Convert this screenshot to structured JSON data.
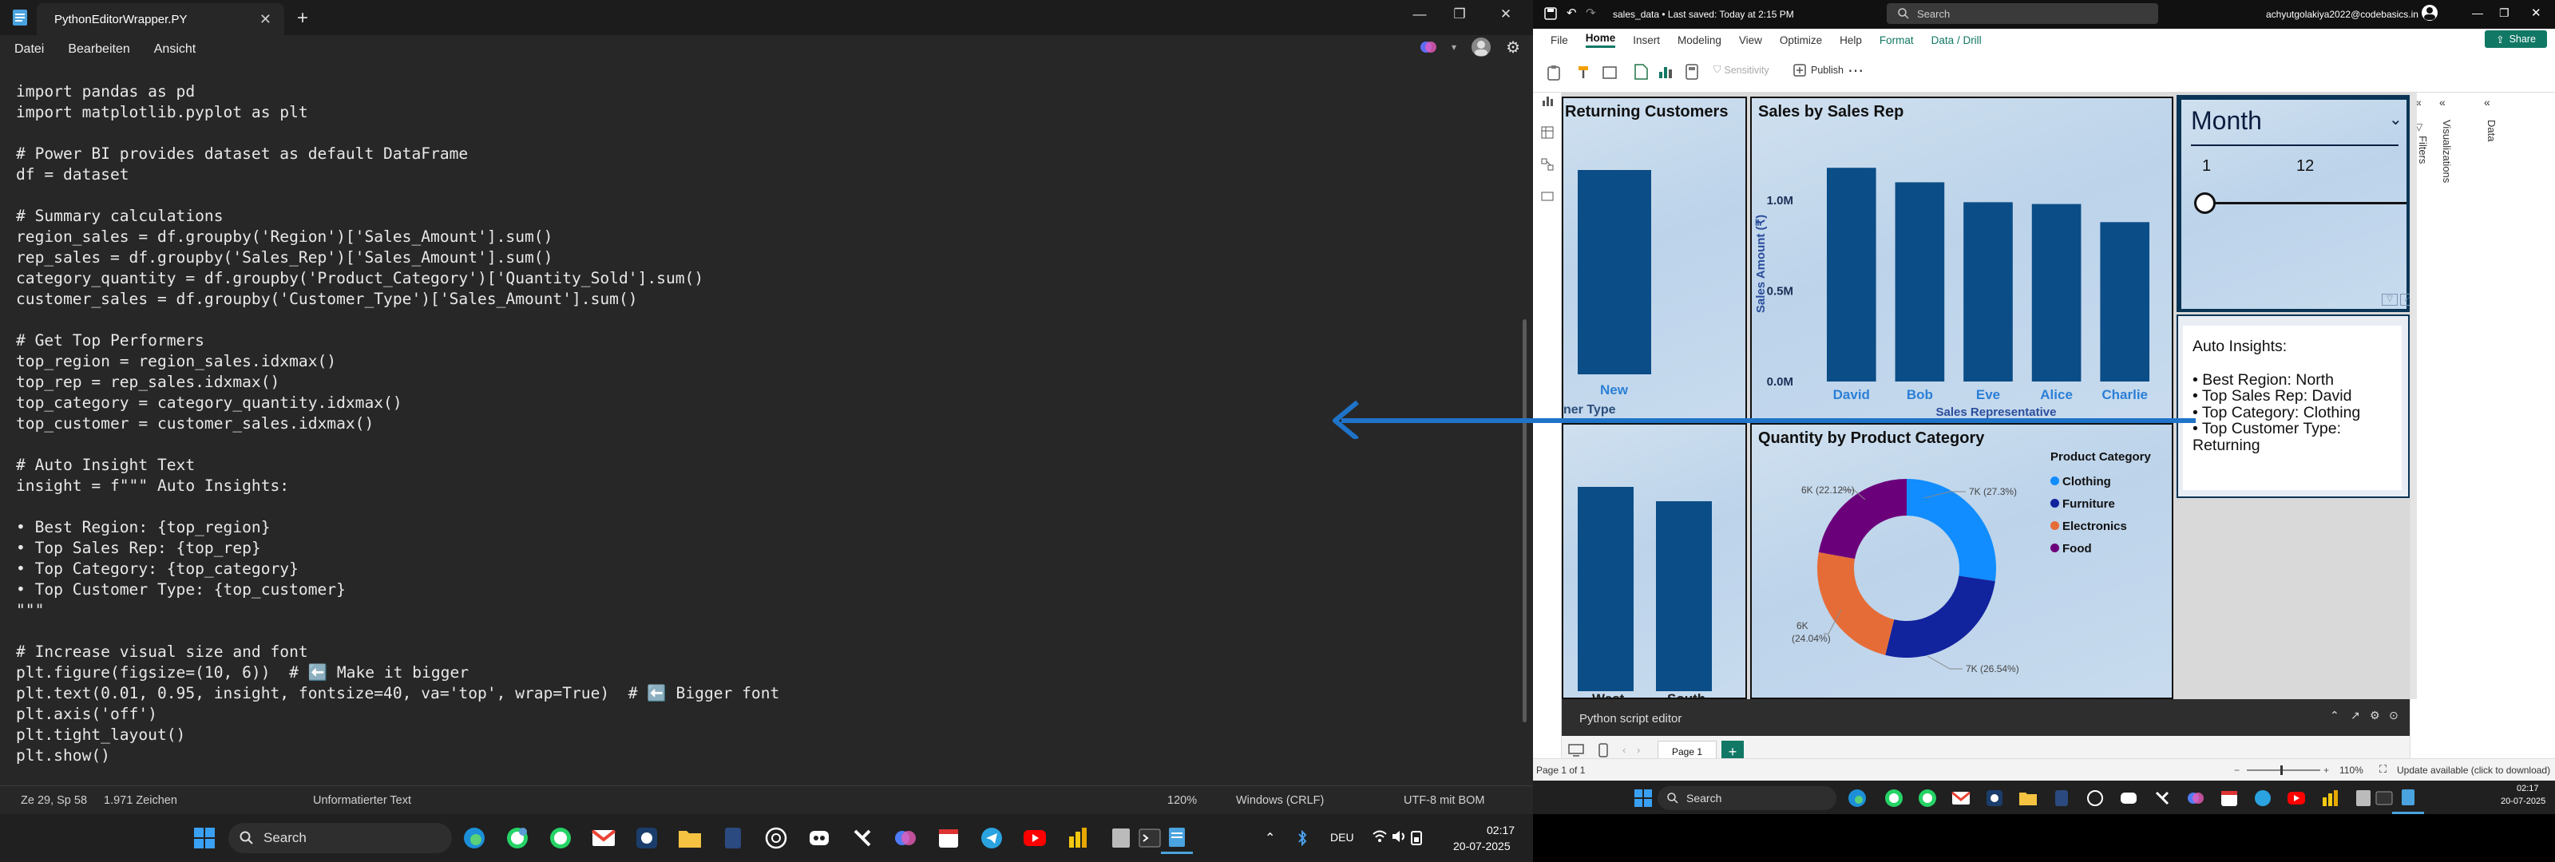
{
  "notepad": {
    "tab_title": "PythonEditorWrapper.PY",
    "menu": [
      "Datei",
      "Bearbeiten",
      "Ansicht"
    ],
    "code_lines": [
      "import pandas as pd",
      "import matplotlib.pyplot as plt",
      "",
      "# Power BI provides dataset as default DataFrame",
      "df = dataset",
      "",
      "# Summary calculations",
      "region_sales = df.groupby('Region')['Sales_Amount'].sum()",
      "rep_sales = df.groupby('Sales_Rep')['Sales_Amount'].sum()",
      "category_quantity = df.groupby('Product_Category')['Quantity_Sold'].sum()",
      "customer_sales = df.groupby('Customer_Type')['Sales_Amount'].sum()",
      "",
      "# Get Top Performers",
      "top_region = region_sales.idxmax()",
      "top_rep = rep_sales.idxmax()",
      "top_category = category_quantity.idxmax()",
      "top_customer = customer_sales.idxmax()",
      "",
      "# Auto Insight Text",
      "insight = f\"\"\" Auto Insights:",
      "",
      "• Best Region: {top_region}",
      "• Top Sales Rep: {top_rep}",
      "• Top Category: {top_category}",
      "• Top Customer Type: {top_customer}",
      "\"\"\"",
      "",
      "# Increase visual size and font",
      "plt.figure(figsize=(10, 6))  # ⬅️ Make it bigger",
      "plt.text(0.01, 0.95, insight, fontsize=40, va='top', wrap=True)  # ⬅️ Bigger font",
      "plt.axis('off')",
      "plt.tight_layout()",
      "plt.show()"
    ],
    "status": {
      "position": "Ze 29, Sp 58",
      "chars": "1.971 Zeichen",
      "format": "Unformatierter Text",
      "zoom": "120%",
      "line_ending": "Windows (CRLF)",
      "encoding": "UTF-8 mit BOM"
    }
  },
  "taskbar_left": {
    "search_label": "Search",
    "lang": "DEU",
    "time": "02:17",
    "date": "20-07-2025"
  },
  "powerbi": {
    "file_title": "sales_data • Last saved: Today at 2:15 PM",
    "search_placeholder": "Search",
    "user_email": "achyutgolakiya2022@codebasics.in",
    "menu": [
      "File",
      "Home",
      "Insert",
      "Modeling",
      "View",
      "Optimize",
      "Help",
      "Format",
      "Data / Drill"
    ],
    "share_label": "Share",
    "ribbon": {
      "sensitivity": "Sensitivity",
      "publish": "Publish"
    },
    "side_panes": [
      "Filters",
      "Visualizations",
      "Data"
    ],
    "returning": {
      "title": "Returning Customers",
      "bar_label": "New",
      "axis_fragment": "ner Type"
    },
    "sales_by_rep": {
      "title": "Sales by Sales Rep",
      "ylabel": "Sales Amount (₹)",
      "xlabel": "Sales Representative",
      "y_ticks": [
        "1.0M",
        "0.5M",
        "0.0M"
      ]
    },
    "region_visual": {
      "labels": [
        "West",
        "South"
      ]
    },
    "quantity": {
      "title": "Quantity by Product Category",
      "legend_title": "Product Category",
      "labels": {
        "clothing": "7K (27.3%)",
        "furniture": "7K (26.54%)",
        "electronics_line1": "6K",
        "electronics_line2": "(24.04%)",
        "food": "6K (22.12%)"
      }
    },
    "slicer": {
      "title": "Month",
      "min": "1",
      "max": "12"
    },
    "insights": {
      "heading": "Auto Insights:",
      "items": [
        "• Best Region: North",
        "• Top Sales Rep: David",
        "• Top Category: Clothing",
        "• Top Customer Type: Returning"
      ]
    },
    "script_editor_label": "Python script editor",
    "page_tab": "Page 1",
    "status_page": "Page 1 of 1",
    "zoom": "110%",
    "update_text": "Update available (click to download)"
  },
  "taskbar_right": {
    "search_label": "Search",
    "time": "02:17",
    "date": "20-07-2025"
  },
  "chart_data": [
    {
      "type": "bar",
      "title": "Sales by Sales Rep",
      "xlabel": "Sales Representative",
      "ylabel": "Sales Amount (₹)",
      "categories": [
        "David",
        "Bob",
        "Eve",
        "Alice",
        "Charlie"
      ],
      "values": [
        1180000,
        1100000,
        990000,
        980000,
        880000
      ],
      "ylim": [
        0,
        1300000
      ]
    },
    {
      "type": "pie",
      "title": "Quantity by Product Category",
      "legend_title": "Product Category",
      "categories": [
        "Clothing",
        "Furniture",
        "Electronics",
        "Food"
      ],
      "values": [
        27.3,
        26.54,
        24.04,
        22.12
      ],
      "colors": [
        "#118DFF",
        "#12239E",
        "#E66C37",
        "#6B007B"
      ]
    }
  ]
}
